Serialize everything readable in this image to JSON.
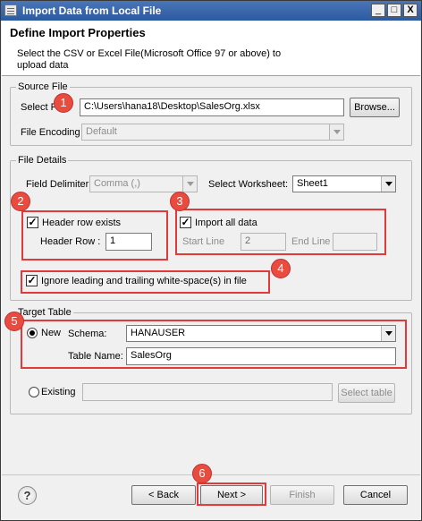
{
  "window": {
    "title": "Import Data from Local File",
    "controls": [
      "_",
      "□",
      "X"
    ]
  },
  "header": {
    "title": "Define Import Properties",
    "description": "Select the CSV or Excel File(Microsoft Office 97 or above) to upload data"
  },
  "source_file": {
    "legend": "Source File",
    "select_label": "Select File",
    "path": "C:\\Users\\hana18\\Desktop\\SalesOrg.xlsx",
    "browse_label": "Browse...",
    "encoding_label": "File Encoding",
    "encoding_value": "Default"
  },
  "file_details": {
    "legend": "File Details",
    "delimiter_label": "Field Delimiter",
    "delimiter_value": "Comma (,)",
    "worksheet_label": "Select Worksheet:",
    "worksheet_value": "Sheet1",
    "header_row_exists_label": "Header row exists",
    "header_row_exists_checked": true,
    "header_row_label": "Header Row :",
    "header_row_value": "1",
    "import_all_label": "Import all data",
    "import_all_checked": true,
    "start_line_label": "Start Line",
    "start_line_value": "2",
    "end_line_label": "End Line",
    "end_line_value": "",
    "ignore_whitespace_label": "Ignore leading and trailing white-space(s) in file",
    "ignore_whitespace_checked": true
  },
  "target_table": {
    "legend": "Target Table",
    "new_label": "New",
    "new_selected": true,
    "schema_label": "Schema:",
    "schema_value": "HANAUSER",
    "table_name_label": "Table Name:",
    "table_name_value": "SalesOrg",
    "existing_label": "Existing",
    "existing_value": "",
    "select_table_label": "Select table"
  },
  "footer": {
    "help_glyph": "?",
    "back_label": "< Back",
    "next_label": "Next >",
    "finish_label": "Finish",
    "cancel_label": "Cancel"
  },
  "callouts": [
    "1",
    "2",
    "3",
    "4",
    "5",
    "6"
  ],
  "colors": {
    "highlight": "#e03a3a",
    "badge": "#ea4b3f",
    "titlebar": "#2c5aa0"
  }
}
